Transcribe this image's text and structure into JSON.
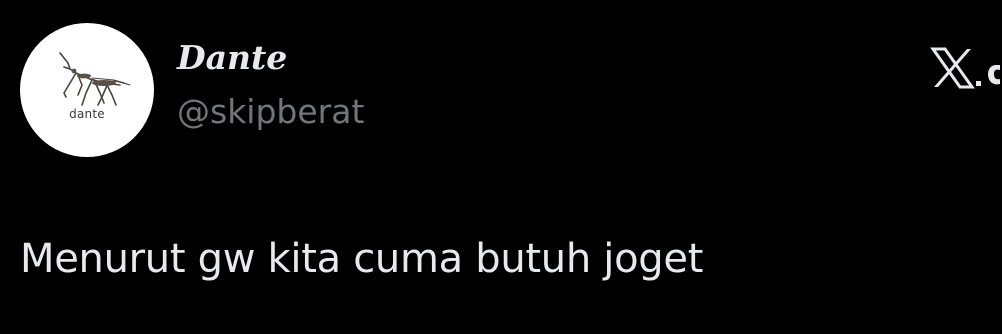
{
  "tweet": {
    "author": {
      "display_name": "Dante",
      "handle": "@skipberat",
      "avatar_label": "dante",
      "avatar_icon": "praying-mantis-icon"
    },
    "text": "Menurut gw kita cuma butuh joget",
    "brand": {
      "logo_icon": "x-logo-icon"
    }
  },
  "colors": {
    "background": "#000000",
    "primary_text": "#e7e9ea",
    "secondary_text": "#71767b",
    "avatar_background": "#ffffff"
  }
}
